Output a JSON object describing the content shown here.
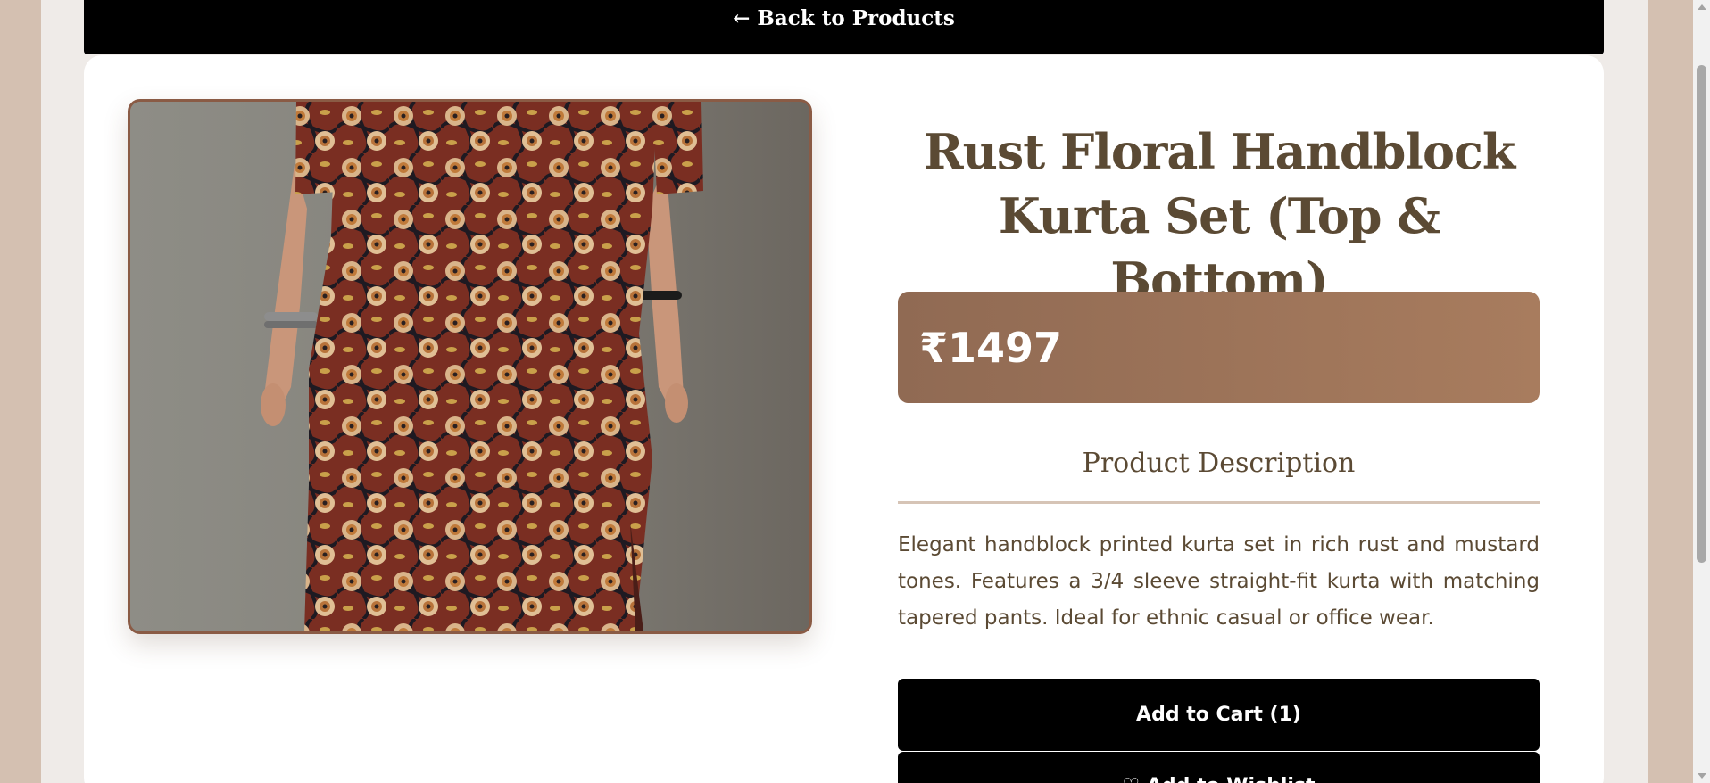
{
  "nav": {
    "back_label": "← Back to Products"
  },
  "product": {
    "title_line1": "Rust Floral Handblock",
    "title_line2": "Kurta Set (Top & Bottom)",
    "price": "₹1497",
    "description_heading": "Product Description",
    "description": "Elegant handblock printed kurta set in rich rust and mustard tones. Features a 3/4 sleeve straight-fit kurta with matching tapered pants. Ideal for ethnic casual or office wear."
  },
  "actions": {
    "add_to_cart_label": "Add to Cart (1)",
    "wishlist_label": "♡ Add to Wishlist"
  },
  "colors": {
    "accent_brown": "#a87c5e",
    "heading_text": "#5b4a34",
    "page_background": "#d4c0b1",
    "button_black": "#000000"
  }
}
